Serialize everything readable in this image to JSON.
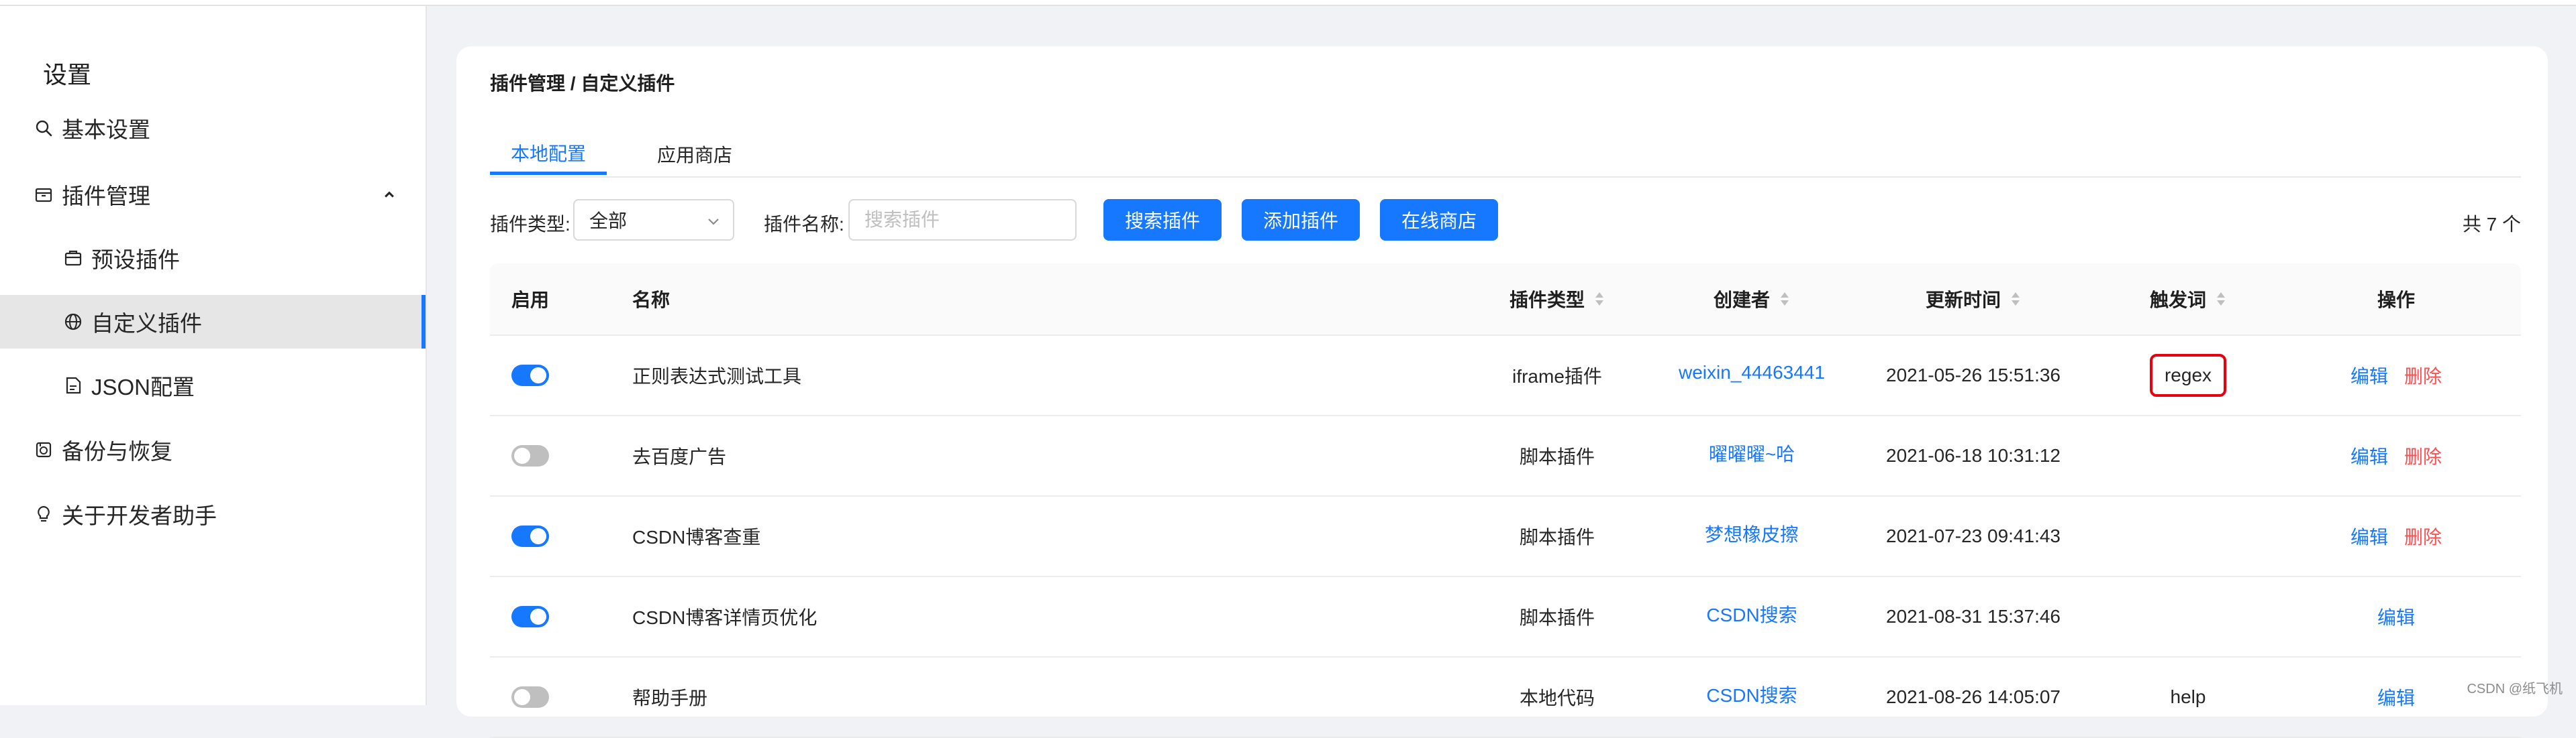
{
  "sidebar": {
    "title": "设置",
    "items": [
      {
        "label": "基本设置",
        "icon": "search-icon"
      },
      {
        "label": "插件管理",
        "icon": "box-icon",
        "expanded": true
      },
      {
        "label": "预设插件",
        "icon": "package-icon"
      },
      {
        "label": "自定义插件",
        "icon": "globe-icon",
        "active": true
      },
      {
        "label": "JSON配置",
        "icon": "json-file-icon"
      },
      {
        "label": "备份与恢复",
        "icon": "backup-icon"
      },
      {
        "label": "关于开发者助手",
        "icon": "bulb-icon"
      }
    ]
  },
  "breadcrumb": "插件管理 / 自定义插件",
  "tabs": [
    {
      "label": "本地配置",
      "active": true
    },
    {
      "label": "应用商店",
      "active": false
    }
  ],
  "filters": {
    "type_label": "插件类型:",
    "type_value": "全部",
    "name_label": "插件名称:",
    "name_placeholder": "搜索插件",
    "search_button": "搜索插件",
    "add_button": "添加插件",
    "store_button": "在线商店",
    "total": "共 7 个"
  },
  "table": {
    "columns": [
      "启用",
      "名称",
      "插件类型",
      "创建者",
      "更新时间",
      "触发词",
      "操作"
    ],
    "rows": [
      {
        "enabled": true,
        "name": "正则表达式测试工具",
        "type": "iframe插件",
        "creator": "weixin_44463441",
        "updated": "2021-05-26 15:51:36",
        "trigger": "regex",
        "trigger_highlighted": true,
        "edit": "编辑",
        "delete": "删除"
      },
      {
        "enabled": false,
        "name": "去百度广告",
        "type": "脚本插件",
        "creator": "曜曜曜~哈",
        "updated": "2021-06-18 10:31:12",
        "trigger": "",
        "edit": "编辑",
        "delete": "删除"
      },
      {
        "enabled": true,
        "name": "CSDN博客查重",
        "type": "脚本插件",
        "creator": "梦想橡皮擦",
        "updated": "2021-07-23 09:41:43",
        "trigger": "",
        "edit": "编辑",
        "delete": "删除"
      },
      {
        "enabled": true,
        "name": "CSDN博客详情页优化",
        "type": "脚本插件",
        "creator": "CSDN搜索",
        "updated": "2021-08-31 15:37:46",
        "trigger": "",
        "edit": "编辑",
        "delete": ""
      },
      {
        "enabled": false,
        "name": "帮助手册",
        "type": "本地代码",
        "creator": "CSDN搜索",
        "updated": "2021-08-26 14:05:07",
        "trigger": "help",
        "edit": "编辑",
        "delete": ""
      }
    ]
  },
  "watermark": "CSDN @纸飞机",
  "colors": {
    "accent": "#1677ff",
    "danger": "#ff4d4f",
    "highlight": "#e8000f"
  }
}
